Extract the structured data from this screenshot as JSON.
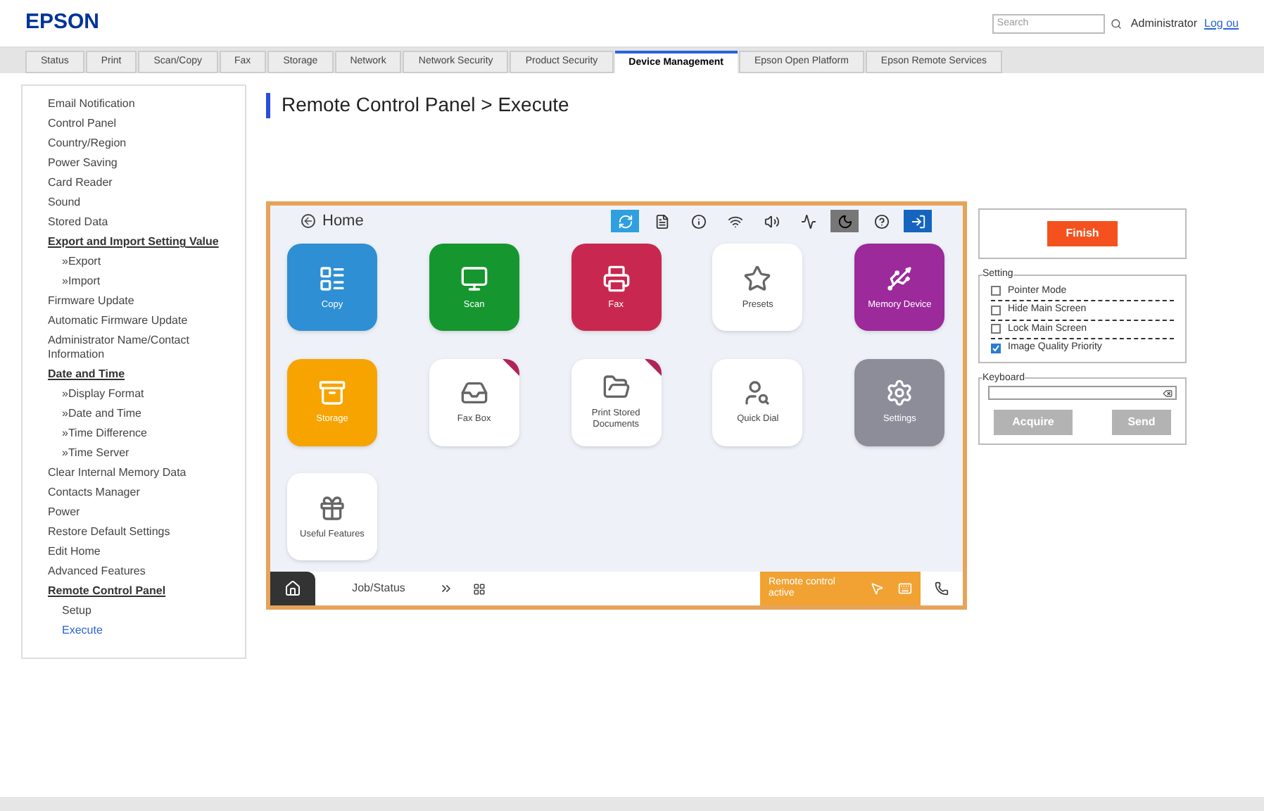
{
  "header": {
    "logo": "EPSON",
    "search": {
      "placeholder": "Search"
    },
    "user": "Administrator",
    "logout": "Log ou"
  },
  "tabs": [
    {
      "label": "Status",
      "selected": false
    },
    {
      "label": "Print",
      "selected": false
    },
    {
      "label": "Scan/Copy",
      "selected": false
    },
    {
      "label": "Fax",
      "selected": false
    },
    {
      "label": "Storage",
      "selected": false
    },
    {
      "label": "Network",
      "selected": false
    },
    {
      "label": "Network Security",
      "selected": false
    },
    {
      "label": "Product Security",
      "selected": false
    },
    {
      "label": "Device Management",
      "selected": true
    },
    {
      "label": "Epson Open Platform",
      "selected": false
    },
    {
      "label": "Epson Remote Services",
      "selected": false
    }
  ],
  "sidebar": {
    "items": [
      {
        "label": "Email Notification",
        "kind": "link",
        "selected": false
      },
      {
        "label": "Control Panel",
        "kind": "link",
        "selected": false
      },
      {
        "label": "Country/Region",
        "kind": "link",
        "selected": false
      },
      {
        "label": "Power Saving",
        "kind": "link",
        "selected": false
      },
      {
        "label": "Card Reader",
        "kind": "link",
        "selected": false
      },
      {
        "label": "Sound",
        "kind": "link",
        "selected": false
      },
      {
        "label": "Stored Data",
        "kind": "link",
        "selected": false
      },
      {
        "label": "Export and Import Setting Value",
        "kind": "heading",
        "children": [
          {
            "label": "»Export",
            "selected": false
          },
          {
            "label": "»Import",
            "selected": false
          }
        ]
      },
      {
        "label": "Firmware Update",
        "kind": "link",
        "selected": false
      },
      {
        "label": "Automatic Firmware Update",
        "kind": "link",
        "selected": false
      },
      {
        "label": "Administrator Name/Contact Information",
        "kind": "link",
        "selected": false
      },
      {
        "label": "Date and Time",
        "kind": "heading",
        "children": [
          {
            "label": "»Display Format",
            "selected": false
          },
          {
            "label": "»Date and Time",
            "selected": false
          },
          {
            "label": "»Time Difference",
            "selected": false
          },
          {
            "label": "»Time Server",
            "selected": false
          }
        ]
      },
      {
        "label": "Clear Internal Memory Data",
        "kind": "link",
        "selected": false
      },
      {
        "label": "Contacts Manager",
        "kind": "link",
        "selected": false
      },
      {
        "label": "Power",
        "kind": "link",
        "selected": false
      },
      {
        "label": "Restore Default Settings",
        "kind": "link",
        "selected": false
      },
      {
        "label": "Edit Home",
        "kind": "link",
        "selected": false
      },
      {
        "label": "Advanced Features",
        "kind": "link",
        "selected": false
      },
      {
        "label": "Remote Control Panel",
        "kind": "heading",
        "children": [
          {
            "label": "Setup",
            "selected": false
          },
          {
            "label": "Execute",
            "selected": true
          }
        ]
      }
    ]
  },
  "page_title": "Remote Control Panel > Execute",
  "panel": {
    "home_label": "Home",
    "apps": [
      {
        "label": "Copy",
        "color": "#2f8fd4",
        "flagged": false
      },
      {
        "label": "Scan",
        "color": "#15962f",
        "flagged": false
      },
      {
        "label": "Fax",
        "color": "#c8284f",
        "flagged": false
      },
      {
        "label": "Presets",
        "color": "#ffffff",
        "flagged": false
      },
      {
        "label": "Memory Device",
        "color": "#9c2a9a",
        "flagged": false
      },
      {
        "label": "Storage",
        "color": "#f7a400",
        "flagged": false
      },
      {
        "label": "Fax Box",
        "color": "#ffffff",
        "flagged": true
      },
      {
        "label": "Print Stored Documents",
        "color": "#ffffff",
        "flagged": true
      },
      {
        "label": "Quick Dial",
        "color": "#ffffff",
        "flagged": false
      },
      {
        "label": "Settings",
        "color": "#8d8d9a",
        "flagged": false
      },
      {
        "label": "Useful Features",
        "color": "#ffffff",
        "flagged": false
      }
    ],
    "job_status": "Job/Status",
    "remote_status": "Remote control active"
  },
  "controls": {
    "finish": "Finish",
    "setting": {
      "legend": "Setting",
      "options": [
        {
          "label": "Pointer Mode",
          "checked": false
        },
        {
          "label": "Hide Main Screen",
          "checked": false
        },
        {
          "label": "Lock Main Screen",
          "checked": false
        },
        {
          "label": "Image Quality Priority",
          "checked": true
        }
      ]
    },
    "keyboard": {
      "legend": "Keyboard",
      "buttons": [
        {
          "label": "Acquire",
          "disabled": true
        },
        {
          "label": "Send",
          "disabled": true
        }
      ]
    }
  }
}
